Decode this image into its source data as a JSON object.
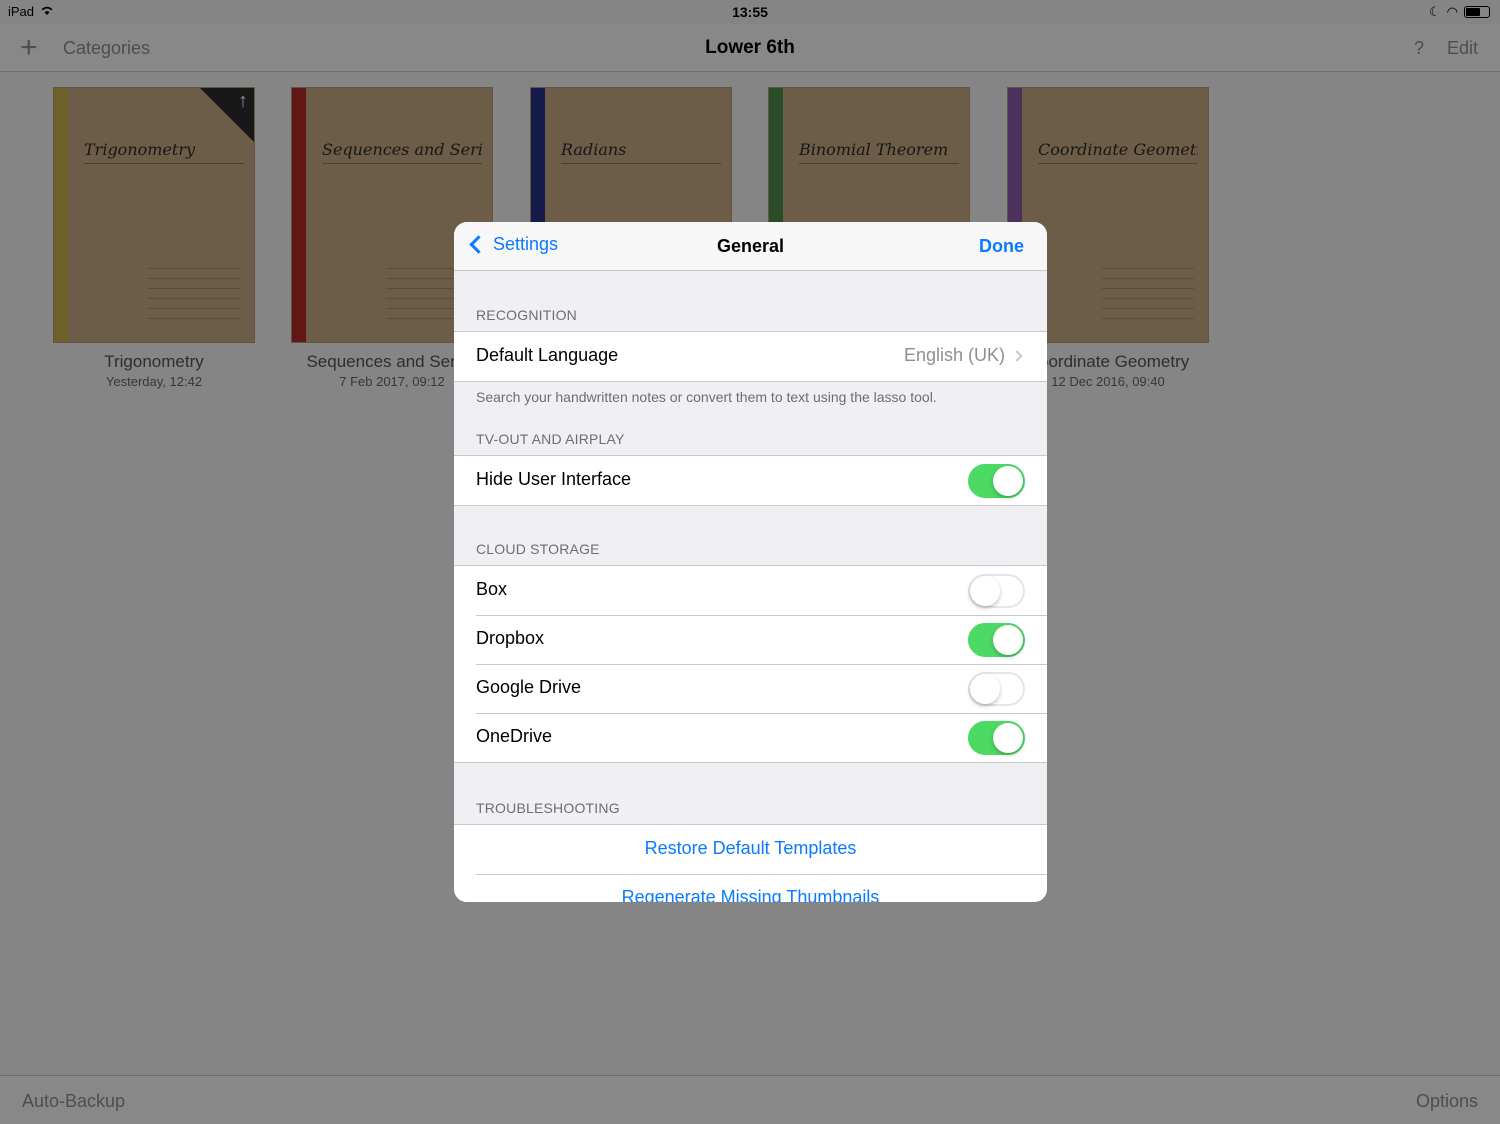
{
  "status_bar": {
    "device": "iPad",
    "time": "13:55"
  },
  "nav": {
    "categories": "Categories",
    "title": "Lower 6th",
    "help": "?",
    "edit": "Edit"
  },
  "notebooks": [
    {
      "title": "Trigonometry",
      "date": "Yesterday, 12:42",
      "cover_text": "Trigonometry",
      "spine_color": "#c9b04a"
    },
    {
      "title": "Sequences and Series",
      "date": "7 Feb 2017, 09:12",
      "cover_text": "Sequences and Series",
      "spine_color": "#b22a2a"
    },
    {
      "title": "Radians",
      "date": "",
      "cover_text": "Radians",
      "spine_color": "#27348b"
    },
    {
      "title": "Binomial Theorem",
      "date": "",
      "cover_text": "Binomial Theorem",
      "spine_color": "#4f8a4c"
    },
    {
      "title": "Coordinate Geometry",
      "date": "12 Dec 2016, 09:40",
      "cover_text": "Coordinate Geometry",
      "spine_color": "#8a5aa6"
    }
  ],
  "toolbar": {
    "left": "Auto-Backup",
    "right": "Options"
  },
  "modal": {
    "back_label": "Settings",
    "title": "General",
    "done_label": "Done",
    "recognition": {
      "header": "RECOGNITION",
      "default_language_label": "Default Language",
      "default_language_value": "English (UK)",
      "footer": "Search your handwritten notes or convert them to text using the lasso tool."
    },
    "tvout": {
      "header": "TV-OUT AND AIRPLAY",
      "hide_ui_label": "Hide User Interface",
      "hide_ui_on": true
    },
    "cloud": {
      "header": "CLOUD STORAGE",
      "items": [
        {
          "label": "Box",
          "on": false
        },
        {
          "label": "Dropbox",
          "on": true
        },
        {
          "label": "Google Drive",
          "on": false
        },
        {
          "label": "OneDrive",
          "on": true
        }
      ]
    },
    "troubleshooting": {
      "header": "TROUBLESHOOTING",
      "restore_label": "Restore Default Templates",
      "regenerate_label": "Regenerate Missing Thumbnails"
    }
  },
  "colors": {
    "accent": "#0a7aff",
    "toggle_on": "#4cd964"
  }
}
